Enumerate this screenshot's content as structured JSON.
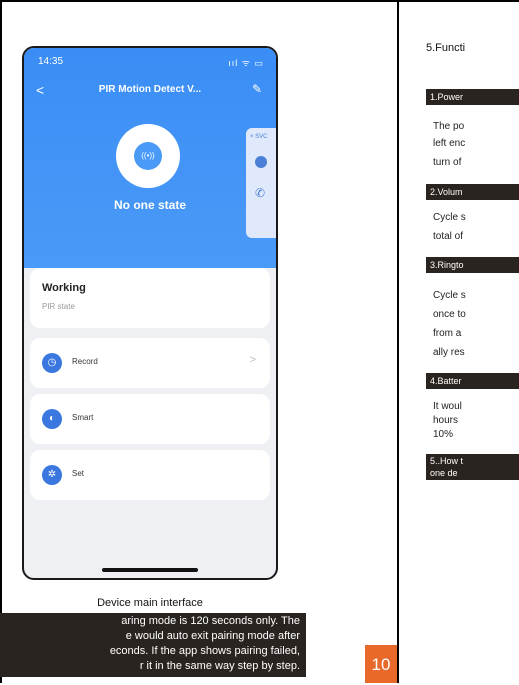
{
  "phone": {
    "time": "14:35",
    "status_icons": "ııl ᯤ ▭",
    "back": "<",
    "title": "PIR Motion Detect V...",
    "edit": "✎",
    "sensor_symbol": "((•))",
    "state": "No one state",
    "svc_label": "× SVC",
    "working_title": "Working",
    "working_sub": "PIR state",
    "menu": [
      {
        "label": "Record",
        "icon": "clock-icon",
        "glyph": "◷",
        "chevron": ">"
      },
      {
        "label": "Smart",
        "icon": "toggle-icon",
        "glyph": "◐",
        "chevron": ""
      },
      {
        "label": "Set",
        "icon": "gear-icon",
        "glyph": "✲",
        "chevron": ""
      }
    ]
  },
  "caption": "Device main interface",
  "note_lines": [
    "aring mode is 120 seconds only. The",
    "e would auto exit pairing mode after",
    "econds. If the app shows pairing failed,",
    "r it in the same way step by step."
  ],
  "page_number": "10",
  "section_title": "5.Functi",
  "items": [
    {
      "heading": "1.Power",
      "lines": [
        "The po",
        "left enc",
        "turn of"
      ]
    },
    {
      "heading": "2.Volum",
      "lines": [
        "Cycle s",
        "total of"
      ]
    },
    {
      "heading": "3.Ringto",
      "lines": [
        "Cycle s",
        "once to",
        "from a",
        "ally res"
      ]
    },
    {
      "heading": "4.Batter",
      "lines": [
        "It woul",
        "hours",
        "10%"
      ]
    },
    {
      "heading": "5..How t",
      "lines": [
        "one de"
      ]
    }
  ]
}
